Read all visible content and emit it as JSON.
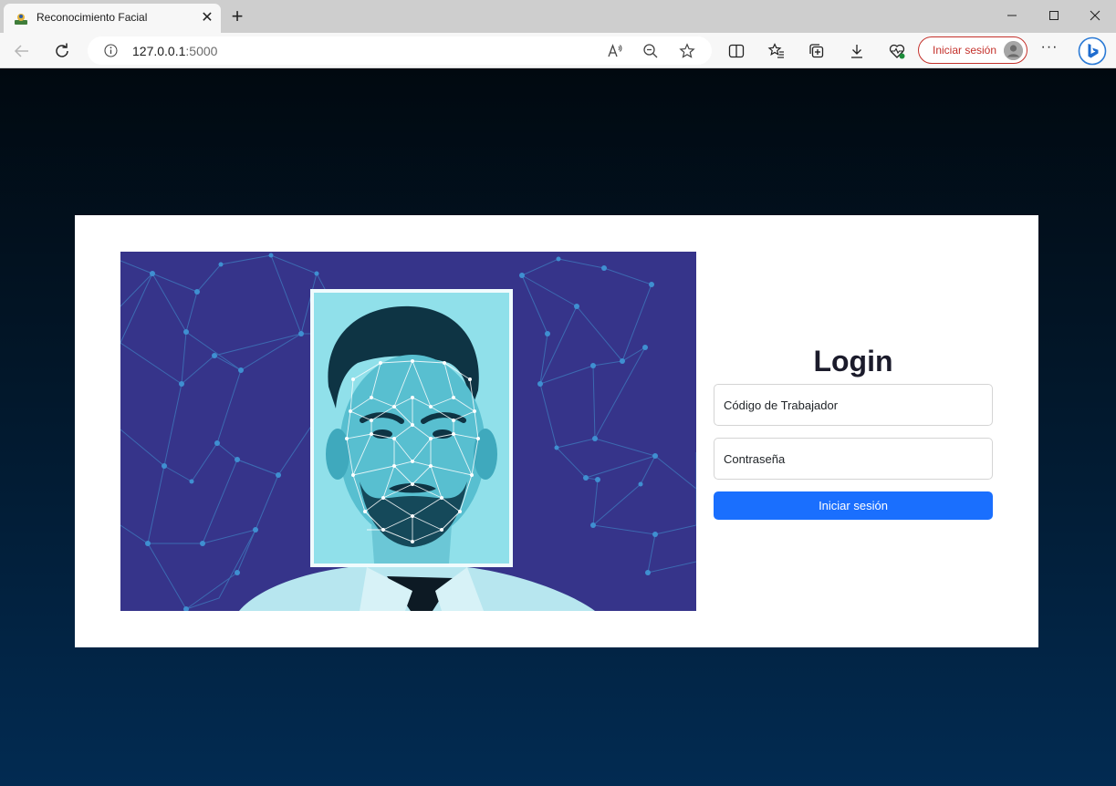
{
  "browser": {
    "tab_title": "Reconocimiento Facial",
    "url_host": "127.0.0.1",
    "url_port": ":5000",
    "signin_label": "Iniciar sesión"
  },
  "login": {
    "title": "Login",
    "code_placeholder": "Código de Trabajador",
    "password_placeholder": "Contraseña",
    "submit_label": "Iniciar sesión"
  },
  "colors": {
    "primary_button": "#1a6ffe",
    "hero_background": "#36348a",
    "page_background_top": "#010910",
    "page_background_bottom": "#022b52",
    "signin_accent": "#c4312b"
  },
  "icons": [
    "back-arrow-icon",
    "refresh-icon",
    "info-icon",
    "read-aloud-icon",
    "zoom-out-icon",
    "favorite-star-icon",
    "split-screen-icon",
    "favorites-list-icon",
    "collections-icon",
    "download-icon",
    "browser-health-icon",
    "copilot-icon"
  ]
}
